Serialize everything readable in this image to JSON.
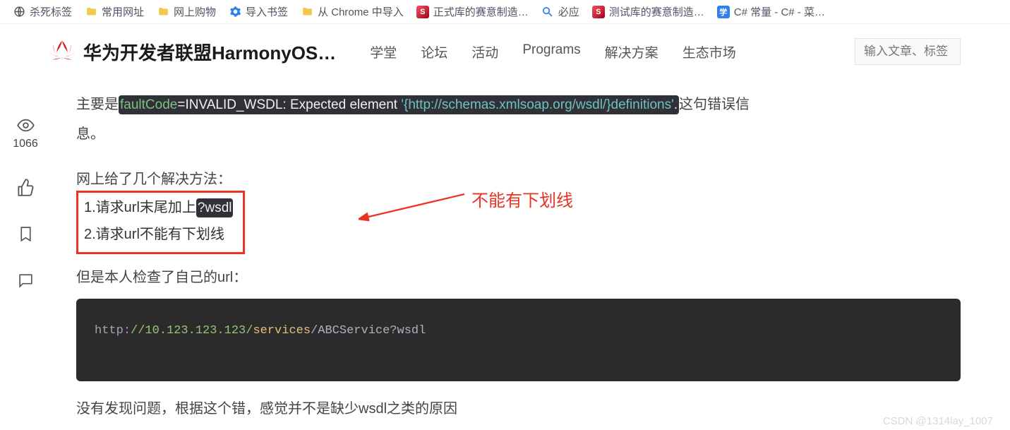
{
  "bookmarks": [
    {
      "label": "杀死标签",
      "icon": "globe"
    },
    {
      "label": "常用网址",
      "icon": "folder"
    },
    {
      "label": "网上购物",
      "icon": "folder"
    },
    {
      "label": "导入书签",
      "icon": "gear"
    },
    {
      "label": "从 Chrome 中导入",
      "icon": "folder"
    },
    {
      "label": "正式库的赛意制造…",
      "icon": "s"
    },
    {
      "label": "必应",
      "icon": "bing"
    },
    {
      "label": "测试库的赛意制造…",
      "icon": "s"
    },
    {
      "label": "C# 常量 - C# - 菜…",
      "icon": "cs"
    }
  ],
  "site": {
    "title": "华为开发者联盟HarmonyOS…",
    "nav": [
      "学堂",
      "论坛",
      "活动",
      "Programs",
      "解决方案",
      "生态市场"
    ],
    "search_placeholder": "输入文章、标签"
  },
  "rail": {
    "views_count": "1066"
  },
  "article": {
    "para1_prefix": "主要是",
    "chip1_a": "faultCode",
    "chip1_b": "=INVALID_WSDL: Expected element ",
    "chip1_c": "'{http://schemas.xmlsoap.org/wsdl/}definitions'",
    "chip1_d": ".",
    "para1_suffix_a": "这句错误信",
    "para1_suffix_b": "息。",
    "solutions_title": "网上给了几个解决方法：",
    "sol1": "1.请求url末尾加上",
    "sol1_chip": "?wsdl",
    "sol2": "2.请求url不能有下划线",
    "annotation": "不能有下划线",
    "after_box": "但是本人检查了自己的url：",
    "code": {
      "a": "http",
      "b": ":",
      "c": "//10.123.123.123/",
      "d": "services",
      "e": "/",
      "f": "ABCService?wsdl"
    },
    "bottom": "没有发现问题，根据这个错，感觉并不是缺少wsdl之类的原因",
    "watermark": "CSDN @1314lay_1007"
  },
  "cs_icon_text": "学"
}
